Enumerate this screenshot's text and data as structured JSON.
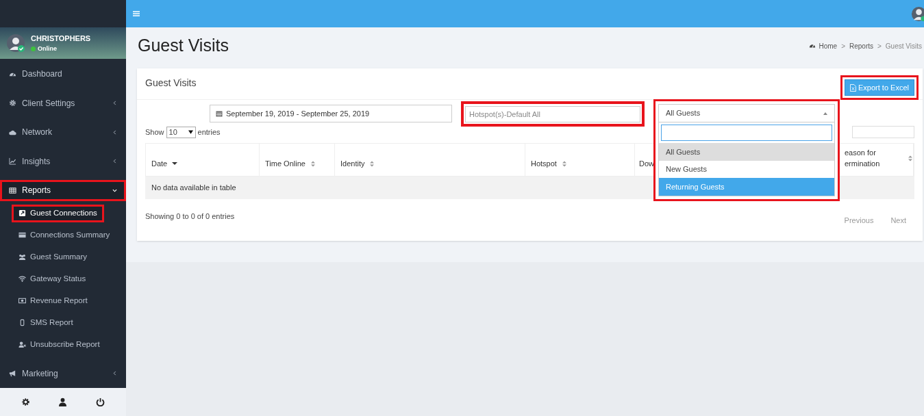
{
  "user": {
    "name": "CHRISTOPHERS",
    "status": "Online"
  },
  "sidebar": {
    "items": [
      {
        "label": "Dashboard",
        "has_children": false,
        "expanded": false,
        "highlighted": false
      },
      {
        "label": "Client Settings",
        "has_children": true,
        "expanded": false,
        "highlighted": false
      },
      {
        "label": "Network",
        "has_children": true,
        "expanded": false,
        "highlighted": false
      },
      {
        "label": "Insights",
        "has_children": true,
        "expanded": false,
        "highlighted": false
      },
      {
        "label": "Reports",
        "has_children": true,
        "expanded": true,
        "highlighted": true,
        "children": [
          {
            "label": "Guest Connections",
            "selected": true,
            "highlighted": true
          },
          {
            "label": "Connections Summary",
            "selected": false,
            "highlighted": false
          },
          {
            "label": "Guest Summary",
            "selected": false,
            "highlighted": false
          },
          {
            "label": "Gateway Status",
            "selected": false,
            "highlighted": false
          },
          {
            "label": "Revenue Report",
            "selected": false,
            "highlighted": false
          },
          {
            "label": "SMS Report",
            "selected": false,
            "highlighted": false
          },
          {
            "label": "Unsubscribe Report",
            "selected": false,
            "highlighted": false
          }
        ]
      },
      {
        "label": "Marketing",
        "has_children": true,
        "expanded": false,
        "highlighted": false
      }
    ]
  },
  "page_title": "Guest Visits",
  "breadcrumb": {
    "separator": ">",
    "links": [
      "Home",
      "Reports",
      "Guest Visits"
    ]
  },
  "card": {
    "title": "Guest Visits",
    "export_button": {
      "label": "Export to Excel",
      "highlighted": true
    },
    "date_range": "September 19, 2019 - September 25, 2019",
    "hotspot_field": {
      "placeholder": "Hotspot(s)-Default All",
      "highlighted": true
    },
    "guest_select": {
      "value": "All Guests",
      "expanded": true,
      "highlighted": true,
      "options": [
        {
          "label": "All Guests",
          "selected": true,
          "hovered": false
        },
        {
          "label": "New Guests",
          "selected": false,
          "hovered": false
        },
        {
          "label": "Returning Guests",
          "selected": false,
          "hovered": true
        }
      ]
    },
    "show_label": "Show",
    "page_size": "10",
    "entries_label": "entries",
    "table": {
      "columns": [
        {
          "label": "Date"
        },
        {
          "label": "Time Online"
        },
        {
          "label": "Identity"
        },
        {
          "label": "Hotspot"
        },
        {
          "label": "Dow"
        },
        {
          "label": "eason for ermination"
        }
      ],
      "empty_message": "No data available in table"
    },
    "info": "Showing 0 to 0 of 0 entries",
    "pagination": [
      "Previous",
      "Next"
    ]
  }
}
